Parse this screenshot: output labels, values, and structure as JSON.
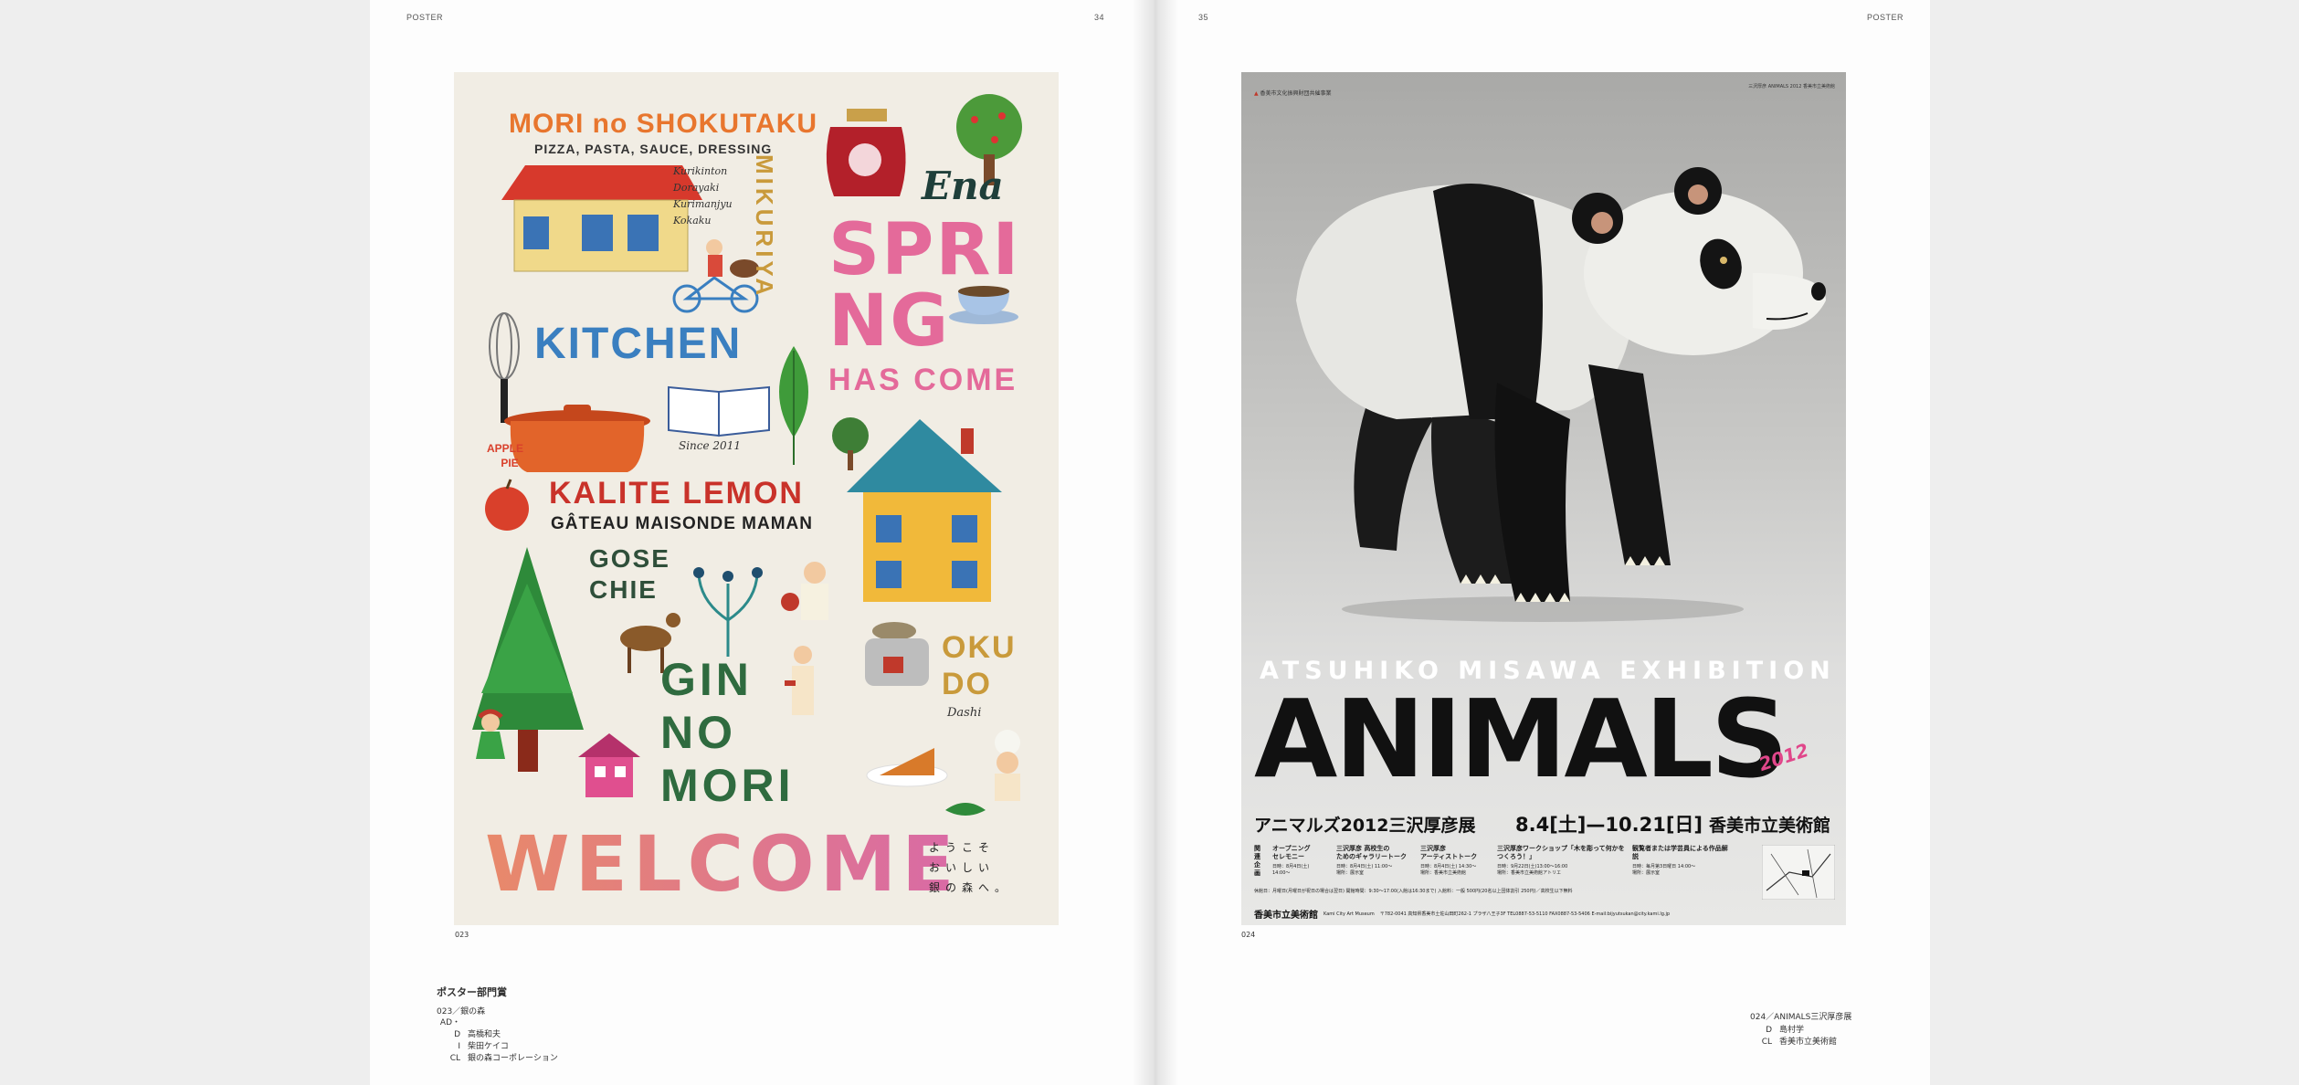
{
  "header": {
    "left_section": "POSTER",
    "left_page": "34",
    "right_page": "35",
    "right_section": "POSTER"
  },
  "left_poster": {
    "title": "MORI no SHOKUTAKU",
    "subtitle": "PIZZA, PASTA, SAUCE, DRESSING",
    "sweets": [
      "Kurikinton",
      "Dorayaki",
      "Kurimanjyu",
      "Kokaku"
    ],
    "mikuriya": "MIKURIYA",
    "ena": "Ena",
    "spring": "SPRI",
    "ng": "NG",
    "has_come": "HAS COME",
    "kitchen": "KITCHEN",
    "since": "Since 2011",
    "apple_pie_1": "APPLE",
    "apple_pie_2": "PIE",
    "kalite": "KALITE LEMON",
    "gateau": "GÂTEAU MAISONDE MAMAN",
    "gose": "GOSE",
    "chie": "CHIE",
    "gin": "GIN",
    "no": "NO",
    "mori": "MORI",
    "oku": "OKU",
    "do": "DO",
    "dashi": "Dashi",
    "welcome": "WELCOME",
    "jp_lines": [
      "ようこそ",
      "おいしい",
      "銀の森へ。"
    ],
    "number": "023"
  },
  "right_poster": {
    "org": "香美市文化振興財団共催事業",
    "top_right_small": "三沢厚彦 ANIMALS 2012 香美市立美術館",
    "exhibition": "ATSUHIKO MISAWA EXHIBITION",
    "animals": "ANIMALS",
    "year": "2012",
    "jp_title": "アニマルズ2012三沢厚彦展",
    "dates": "8.4[土]—10.21[日]",
    "venue": "香美市立美術館",
    "events": [
      {
        "title": "オープニング\nセレモニー",
        "detail": "日時：8月4日(土)\n14:00〜"
      },
      {
        "title": "三沢厚彦 高校生の\nためのギャラリートーク",
        "detail": "日時：8月4日(土) 11:00〜\n場所：展示室"
      },
      {
        "title": "三沢厚彦\nアーティストトーク",
        "detail": "日時：8月4日(土) 14:30〜\n場所：香美市立美術館"
      },
      {
        "title": "三沢厚彦ワークショップ「木を彫って何かをつくろう！」",
        "detail": "日時：9月22日(土)13:00〜16:00\n場所：香美市立美術館アトリエ"
      },
      {
        "title": "観覧者または学芸員による作品解説",
        "detail": "日時：毎月第3日曜日 14:00〜\n場所：展示室"
      }
    ],
    "side_label": "関連企画",
    "info": "休館日：月曜日(月曜日が祝日の場合は翌日) 開館時間：9:30〜17:00(入館は16:30まで)  入館料：一般 500円(20名以上団体割引 250円)／高校生以下無料",
    "footer_venue": "香美市立美術館",
    "footer_en": "Kami City Art Museum",
    "footer_contact": "〒782-0041 高知県香美市土佐山田町262-1 プラザ八王子3F  TEL0887-53-5110  FAX0887-53-5406  E-mail:bijyutsukan@city.kami.lg.jp",
    "number": "024"
  },
  "captions": {
    "award": "ポスター部門賞",
    "left_work": "023／銀の森",
    "left_credits": [
      {
        "role": "AD・D",
        "name": "高橋和夫"
      },
      {
        "role": "I",
        "name": "柴田ケイコ"
      },
      {
        "role": "CL",
        "name": "銀の森コーポレーション"
      }
    ],
    "right_work": "024／ANIMALS三沢厚彦展",
    "right_credits": [
      {
        "role": "D",
        "name": "島村学"
      },
      {
        "role": "CL",
        "name": "香美市立美術館"
      }
    ]
  },
  "colors": {
    "orange": "#e8762e",
    "pink": "#e46a9a",
    "blue": "#3a7fc0",
    "red": "#c9322a",
    "green": "#2f6b3f",
    "gold": "#c99a3b",
    "welcome_start": "#e8896a",
    "welcome_end": "#d96aa6"
  }
}
